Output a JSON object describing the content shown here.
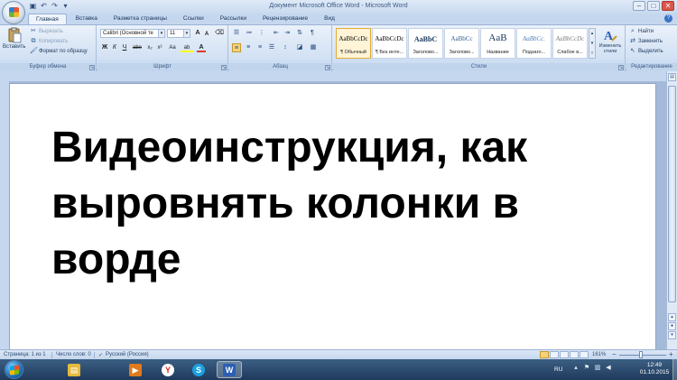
{
  "window": {
    "title": "Документ Microsoft Office Word - Microsoft Word",
    "controls": [
      "–",
      "□",
      "✕"
    ]
  },
  "qat": {
    "icons": [
      "save-icon",
      "undo-icon",
      "redo-icon",
      "customize-qat-icon"
    ]
  },
  "tabs": [
    {
      "label": "Главная",
      "active": true
    },
    {
      "label": "Вставка"
    },
    {
      "label": "Разметка страницы"
    },
    {
      "label": "Ссылки"
    },
    {
      "label": "Рассылки"
    },
    {
      "label": "Рецензирование"
    },
    {
      "label": "Вид"
    }
  ],
  "ribbon": {
    "clipboard": {
      "label": "Буфер обмена",
      "paste": "Вставить",
      "cut": "Вырезать",
      "copy": "Копировать",
      "format_painter": "Формат по образцу"
    },
    "font": {
      "label": "Шрифт",
      "font_name": "Calibri (Основной те",
      "font_size": "11",
      "grow": "A",
      "shrink": "A",
      "bold": "Ж",
      "italic": "К",
      "underline": "Ч",
      "strike": "abe",
      "sub": "x₂",
      "sup": "x²",
      "case": "Aa",
      "highlight": "ab",
      "color": "A"
    },
    "paragraph": {
      "label": "Абзац"
    },
    "styles": {
      "label": "Стили",
      "items": [
        {
          "sample": "AaBbCcDc",
          "name": "¶ Обычный",
          "selected": true
        },
        {
          "sample": "AaBbCcDc",
          "name": "¶ Без инте..."
        },
        {
          "sample": "AaBbC",
          "name": "Заголово..."
        },
        {
          "sample": "AaBbCc",
          "name": "Заголово..."
        },
        {
          "sample": "AaB",
          "name": "Название"
        },
        {
          "sample": "AaBbCc.",
          "name": "Подзаго..."
        },
        {
          "sample": "AaBbCcDc",
          "name": "Слабое в..."
        }
      ],
      "change_styles": "Изменить стили"
    },
    "editing": {
      "label": "Редактирование",
      "find": "Найти",
      "replace": "Заменить",
      "select": "Выделить"
    }
  },
  "document": {
    "heading": "Видеоинструкция, как выровнять колонки в ворде"
  },
  "status": {
    "page": "Страница: 1 из 1",
    "words": "Число слов: 0",
    "language": "Русский (Россия)",
    "zoom": "161%"
  },
  "taskbar": {
    "apps": [
      {
        "icon": "explorer-icon",
        "glyph": "▤",
        "color": "#e7b93d"
      },
      {
        "icon": "media-player-icon",
        "glyph": "▶",
        "color": "#e07a1c"
      },
      {
        "icon": "yandex-browser-icon",
        "glyph": "Y",
        "color": "#ffffff"
      },
      {
        "icon": "skype-icon",
        "glyph": "S",
        "color": "#1ba1e2"
      },
      {
        "icon": "word-icon",
        "glyph": "W",
        "color": "#2b5fb4"
      }
    ],
    "lang": "RU",
    "time": "12:49",
    "date": "01.10.2015"
  },
  "colors": {
    "ribbon_bg": "#d3e2f4",
    "highlight_marker": "#ffff00",
    "font_color_marker": "#e03a2f"
  }
}
